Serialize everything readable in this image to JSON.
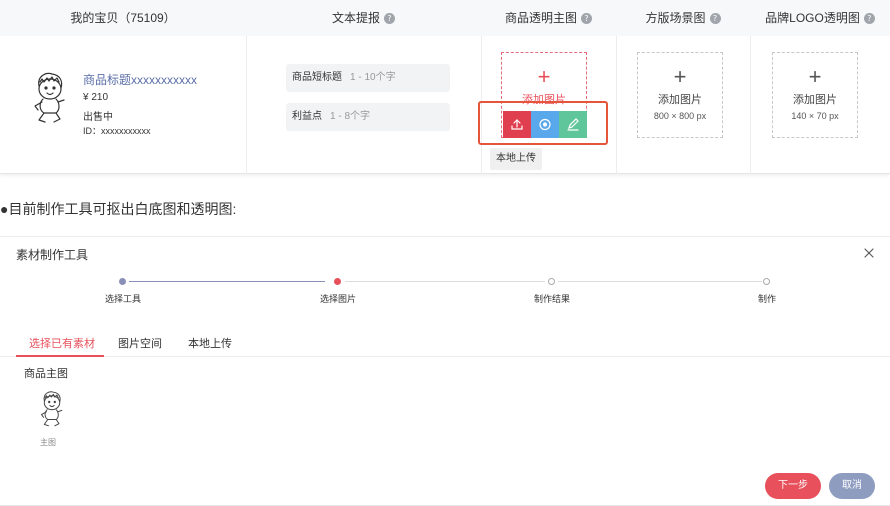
{
  "table": {
    "headers": {
      "baby": "我的宝贝（75109）",
      "text_hint": "文本提报",
      "transparent_main": "商品透明主图",
      "square_scene": "方版场景图",
      "brand_logo": "品牌LOGO透明图"
    },
    "product": {
      "title": "商品标题xxxxxxxxxxx",
      "price": "¥ 210",
      "status": "出售中",
      "id": "ID：xxxxxxxxxxx"
    },
    "fields": {
      "short_title_label": "商品短标题",
      "short_title_placeholder": "1 - 10个字",
      "benefit_label": "利益点",
      "benefit_placeholder": "1 - 8个字"
    },
    "upload": {
      "add_image": "添加图片",
      "scene_size": "800 × 800 px",
      "logo_size": "140 × 70 px",
      "tooltip": "本地上传"
    }
  },
  "note": "●目前制作工具可抠出白底图和透明图:",
  "dialog": {
    "title": "素材制作工具",
    "steps": [
      "选择工具",
      "选择图片",
      "制作结果",
      "制作"
    ],
    "tabs": [
      "选择已有素材",
      "图片空间",
      "本地上传"
    ],
    "section": "商品主图",
    "thumb_label": "主图",
    "next": "下一步",
    "cancel": "取消"
  },
  "colors": {
    "accent_red": "#e8505b",
    "step_done": "#8a8fb8",
    "tool_red": "#df3f4e",
    "tool_blue": "#5aa8ec",
    "tool_green": "#5fc59a",
    "cancel_btn": "#8e9cc0"
  }
}
